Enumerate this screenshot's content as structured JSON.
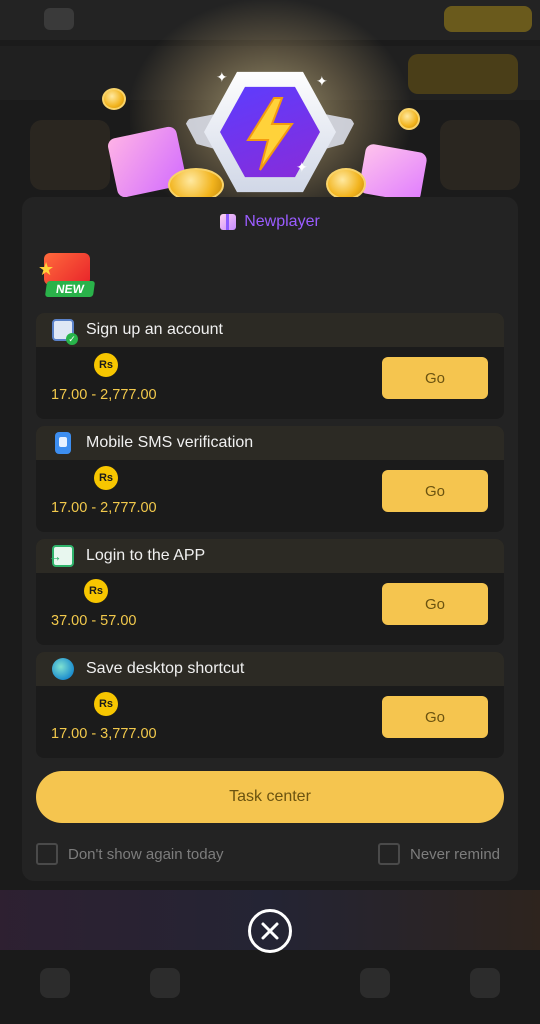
{
  "modal": {
    "title": "Newplayer",
    "badge_label": "NEW",
    "tasks": [
      {
        "name": "Sign up an account",
        "icon": "clipboard-check-icon",
        "currency": "Rs",
        "range": "17.00 - 2,777.00",
        "action": "Go"
      },
      {
        "name": "Mobile SMS verification",
        "icon": "phone-shield-icon",
        "currency": "Rs",
        "range": "17.00 - 2,777.00",
        "action": "Go"
      },
      {
        "name": "Login to the APP",
        "icon": "login-arrow-icon",
        "currency": "Rs",
        "range": "37.00 - 57.00",
        "action": "Go"
      },
      {
        "name": "Save desktop shortcut",
        "icon": "globe-icon",
        "currency": "Rs",
        "range": "17.00 - 3,777.00",
        "action": "Go"
      }
    ],
    "task_center_label": "Task center",
    "dont_show_today_label": "Don't show again today",
    "never_remind_label": "Never remind"
  },
  "colors": {
    "accent_gold": "#f5c54f",
    "title_purple": "#9a5cff",
    "range_yellow": "#f2c94c",
    "modal_bg": "#232323"
  }
}
